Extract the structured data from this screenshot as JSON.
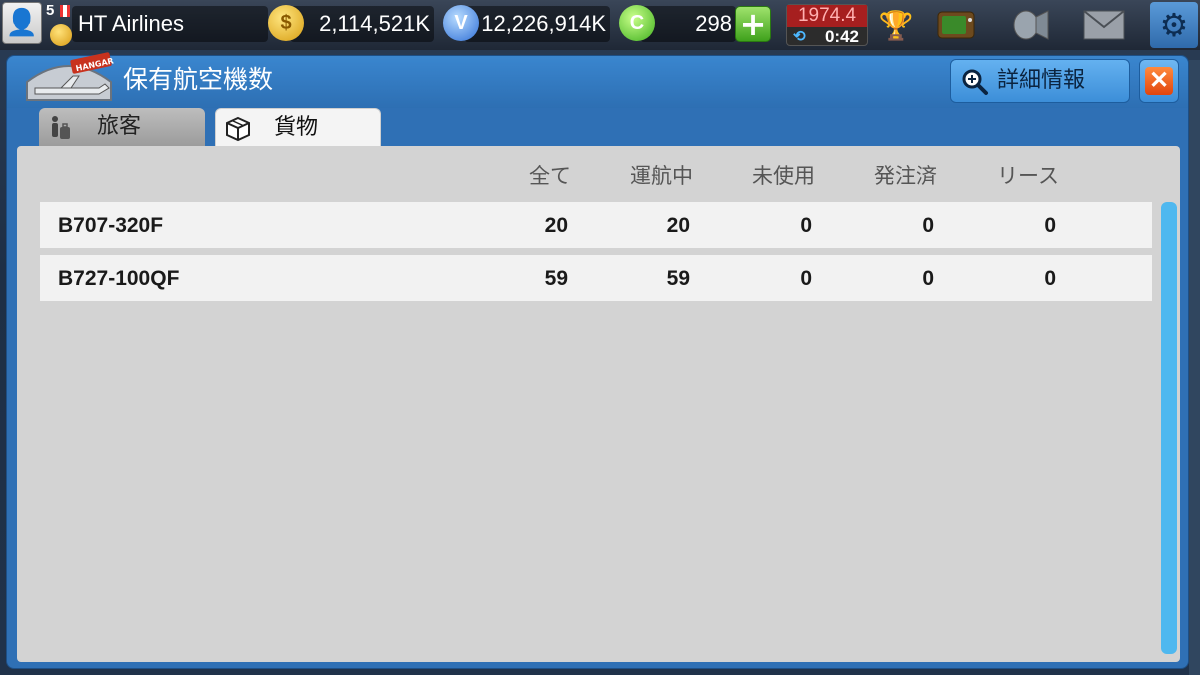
{
  "topbar": {
    "level": "5",
    "airline_name": "HT Airlines",
    "gold": "2,114,521K",
    "vip": "12,226,914K",
    "green": "298",
    "date": "1974.4",
    "timer": "0:42",
    "colors": {
      "date_red": "#a61f1f",
      "plus_green": "#3fa11c"
    }
  },
  "dialog": {
    "title": "保有航空機数",
    "hangar_label": "HANGAR",
    "detail_button": "詳細情報",
    "close_symbol": "✕",
    "tabs": [
      {
        "label": "旅客",
        "active": false
      },
      {
        "label": "貨物",
        "active": true
      }
    ],
    "columns": [
      "全て",
      "運航中",
      "未使用",
      "発注済",
      "リース"
    ],
    "rows": [
      {
        "model": "B707-320F",
        "all": "20",
        "active": "20",
        "unused": "0",
        "ordered": "0",
        "leased": "0"
      },
      {
        "model": "B727-100QF",
        "all": "59",
        "active": "59",
        "unused": "0",
        "ordered": "0",
        "leased": "0"
      }
    ],
    "colors": {
      "header_blue": "#2f70b5",
      "scroll_blue": "#4fb8ef"
    }
  }
}
